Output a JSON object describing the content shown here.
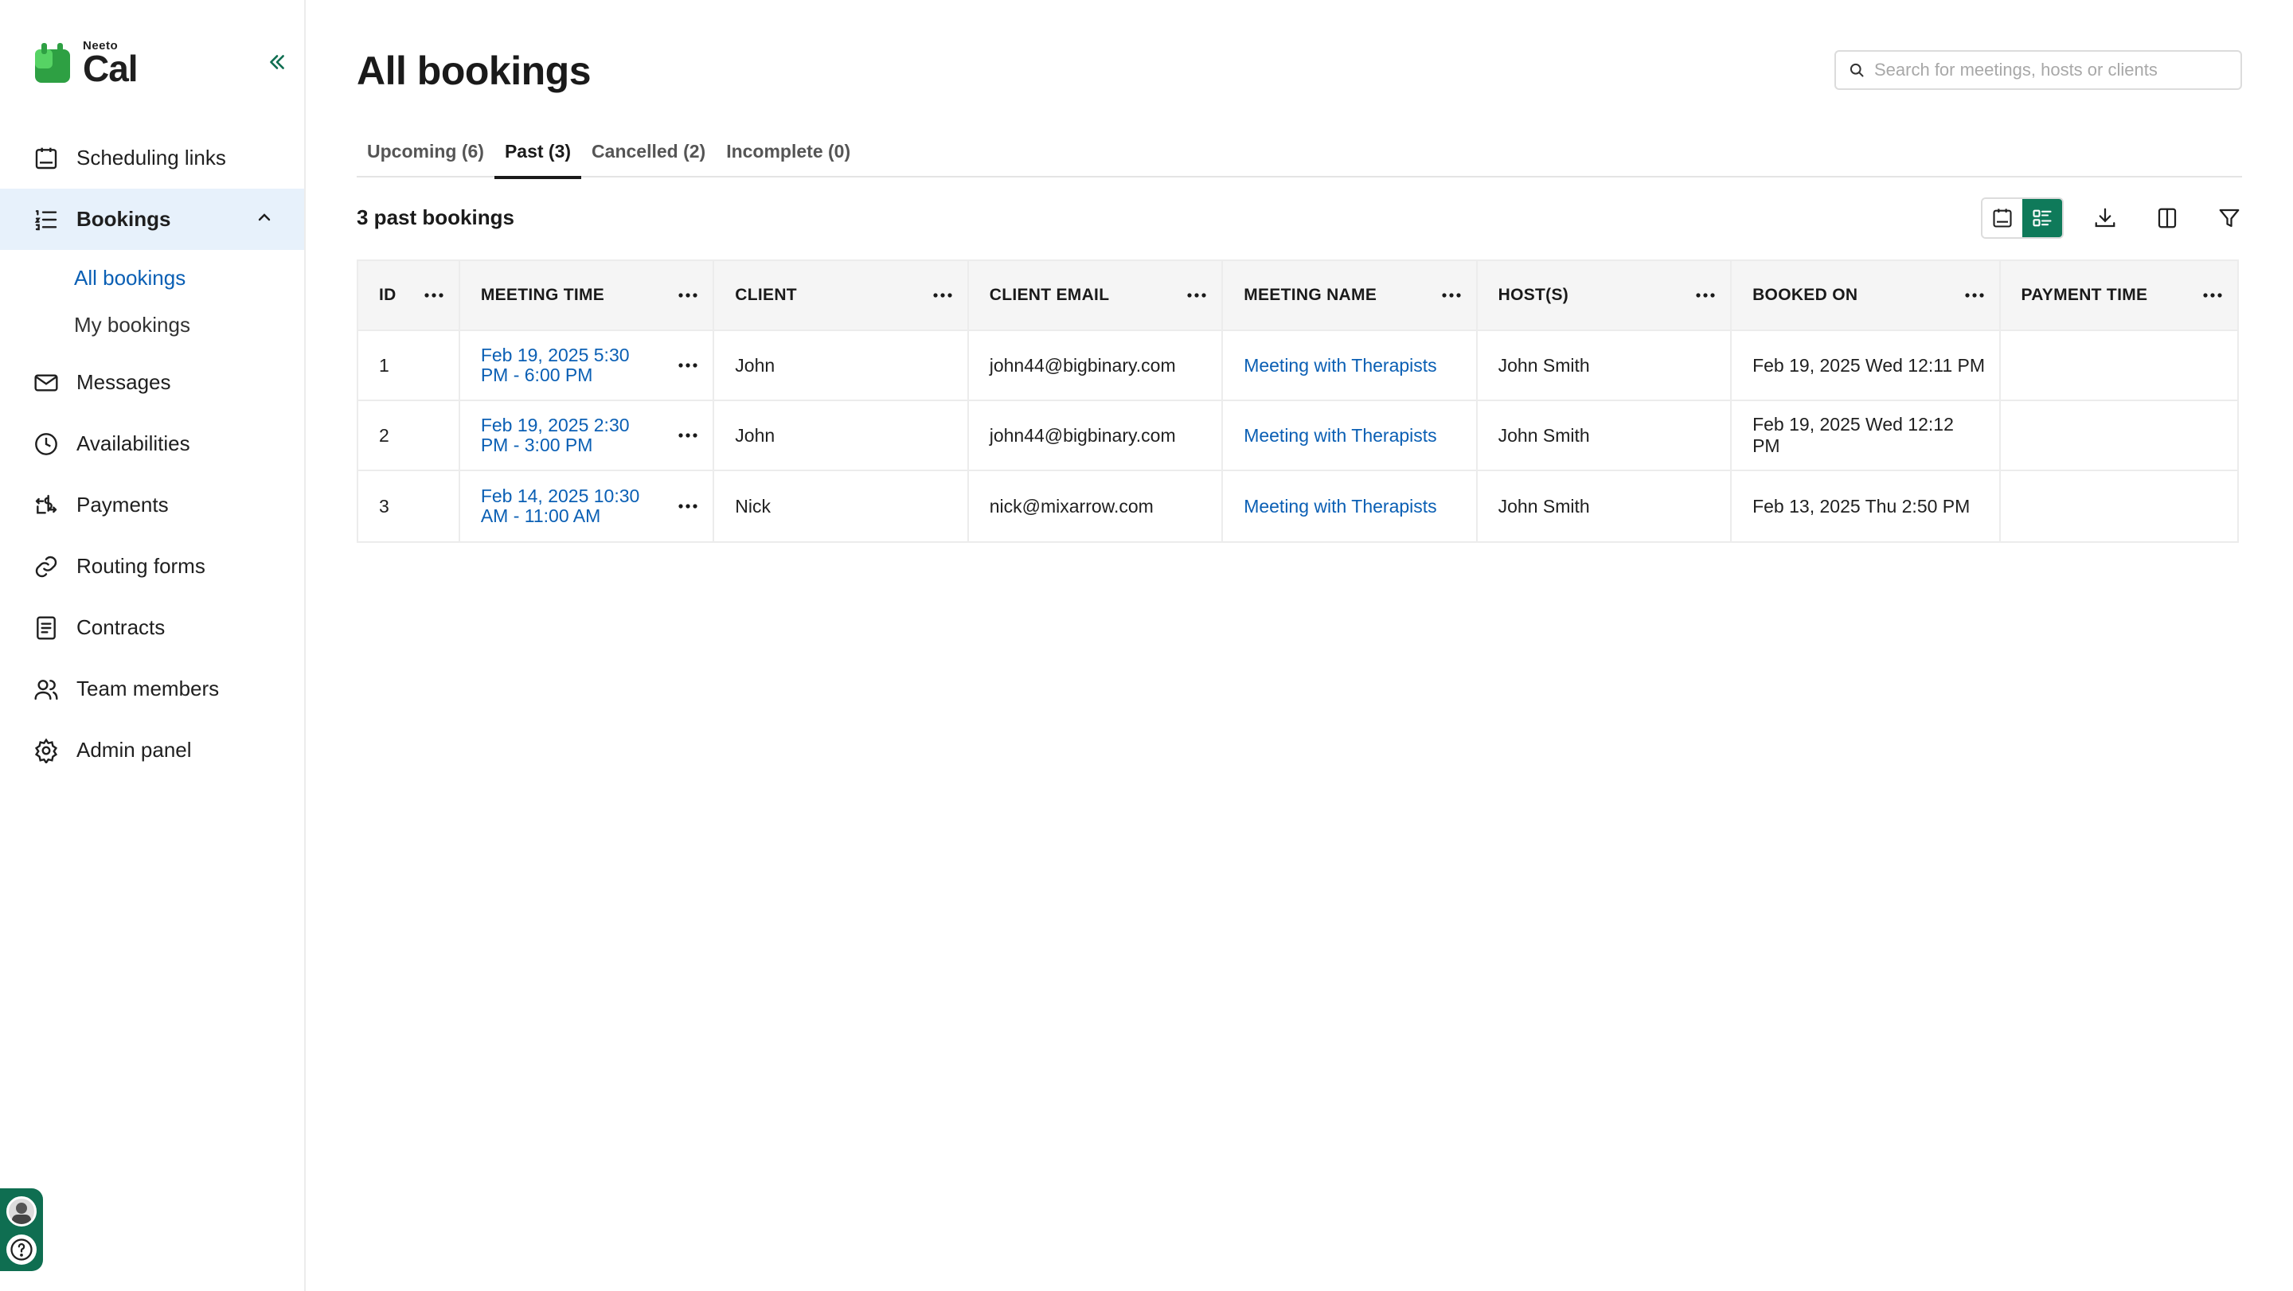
{
  "brand": {
    "small": "Neeto",
    "big": "Cal",
    "color": "#2ea043"
  },
  "sidebar": {
    "items": [
      {
        "label": "Scheduling links",
        "icon": "calendar-icon"
      },
      {
        "label": "Bookings",
        "icon": "list-icon",
        "active": true
      },
      {
        "label": "Messages",
        "icon": "mail-icon"
      },
      {
        "label": "Availabilities",
        "icon": "clock-icon"
      },
      {
        "label": "Payments",
        "icon": "payment-icon"
      },
      {
        "label": "Routing forms",
        "icon": "link-icon"
      },
      {
        "label": "Contracts",
        "icon": "document-icon"
      },
      {
        "label": "Team members",
        "icon": "users-icon"
      },
      {
        "label": "Admin panel",
        "icon": "gear-icon"
      }
    ],
    "sub_items": [
      {
        "label": "All bookings",
        "active": true
      },
      {
        "label": "My bookings"
      }
    ]
  },
  "header": {
    "title": "All bookings",
    "search_placeholder": "Search for meetings, hosts or clients"
  },
  "tabs": [
    {
      "label": "Upcoming (6)"
    },
    {
      "label": "Past (3)",
      "active": true
    },
    {
      "label": "Cancelled (2)"
    },
    {
      "label": "Incomplete (0)"
    }
  ],
  "summary": {
    "count_text": "3 past bookings"
  },
  "table": {
    "columns": [
      "ID",
      "MEETING TIME",
      "CLIENT",
      "CLIENT EMAIL",
      "MEETING NAME",
      "HOST(S)",
      "BOOKED ON",
      "PAYMENT TIME"
    ],
    "rows": [
      {
        "id": "1",
        "meeting_time": "Feb 19, 2025 5:30 PM - 6:00 PM",
        "client": "John",
        "email": "john44@bigbinary.com",
        "meeting_name": "Meeting with Therapists",
        "hosts": "John Smith",
        "booked_on": "Feb 19, 2025 Wed 12:11 PM",
        "payment_time": ""
      },
      {
        "id": "2",
        "meeting_time": "Feb 19, 2025 2:30 PM - 3:00 PM",
        "client": "John",
        "email": "john44@bigbinary.com",
        "meeting_name": "Meeting with Therapists",
        "hosts": "John Smith",
        "booked_on": "Feb 19, 2025 Wed 12:12 PM",
        "payment_time": ""
      },
      {
        "id": "3",
        "meeting_time": "Feb 14, 2025 10:30 AM - 11:00 AM",
        "client": "Nick",
        "email": "nick@mixarrow.com",
        "meeting_name": "Meeting with Therapists",
        "hosts": "John Smith",
        "booked_on": "Feb 13, 2025 Thu 2:50 PM",
        "payment_time": ""
      }
    ]
  },
  "colors": {
    "accent": "#0f7a5a",
    "link": "#0a5fb4",
    "active_bg": "#e7f1fb"
  }
}
